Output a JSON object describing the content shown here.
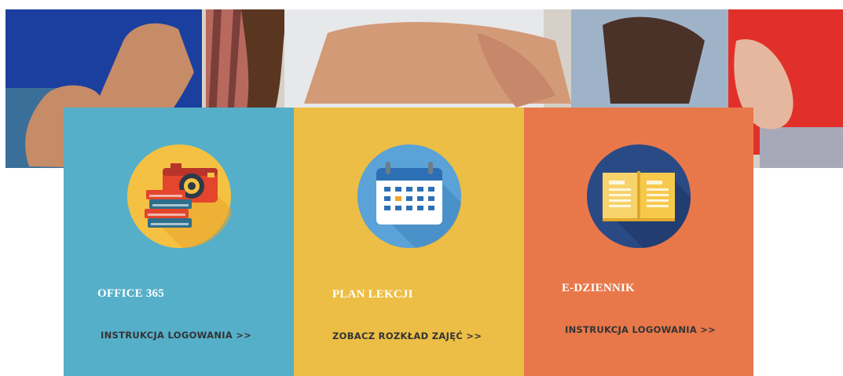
{
  "hero": {
    "alt_icon": "students-photo"
  },
  "cards": [
    {
      "title": "OFFICE 365",
      "link": "INSTRUKCJA LOGOWANIA >>",
      "color": "#56afc9",
      "icon": "camera-books-icon"
    },
    {
      "title": "PLAN LEKCJI",
      "link": "ZOBACZ ROZKŁAD ZAJĘĆ >>",
      "color": "#ecbe45",
      "icon": "calendar-icon"
    },
    {
      "title": "E-DZIENNIK",
      "link": "INSTRUKCJA LOGOWANIA >>",
      "color": "#e8784a",
      "icon": "open-book-icon"
    }
  ]
}
